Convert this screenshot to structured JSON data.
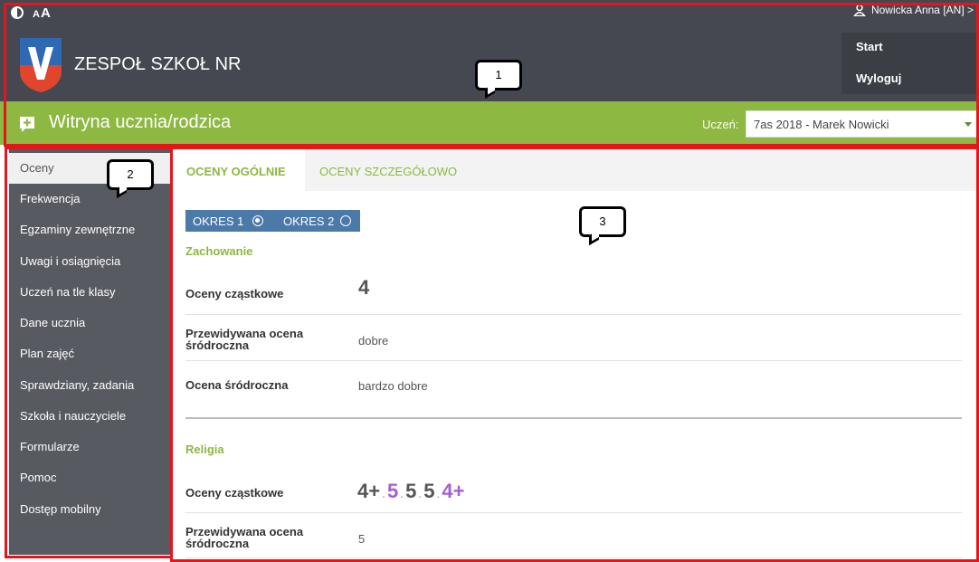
{
  "header": {
    "font_size_label_small": "A",
    "font_size_label_large": "A",
    "school_name": "ZESPOŁ SZKOŁ NR",
    "user_name": "Nowicka Anna [AN] >",
    "menu": [
      "Start",
      "Wyloguj"
    ]
  },
  "portal": {
    "title": "Witryna ucznia/rodzica",
    "student_label": "Uczeń:",
    "student_selected": "7as 2018 - Marek Nowicki"
  },
  "sidebar": {
    "items": [
      "Oceny",
      "Frekwencja",
      "Egzaminy zewnętrzne",
      "Uwagi i osiągnięcia",
      "Uczeń na tle klasy",
      "Dane ucznia",
      "Plan zajęć",
      "Sprawdziany, zadania",
      "Szkoła i nauczyciele",
      "Formularze",
      "Pomoc",
      "Dostęp mobilny"
    ],
    "active_index": 0
  },
  "tabs": [
    "OCENY OGÓLNIE",
    "OCENY SZCZEGÓŁOWO"
  ],
  "periods": [
    {
      "label": "OKRES 1",
      "selected": true
    },
    {
      "label": "OKRES 2",
      "selected": false
    }
  ],
  "subjects": [
    {
      "name": "Zachowanie",
      "partial_label": "Oceny cząstkowe",
      "partial_grades": "4",
      "predicted_label_line1": "Przewidywana ocena",
      "predicted_label_line2": "śródroczna",
      "predicted_value": "dobre",
      "midterm_label": "Ocena śródroczna",
      "midterm_value": "bardzo dobre"
    },
    {
      "name": "Religia",
      "partial_label": "Oceny cząstkowe",
      "partial_grades": [
        "4+",
        "5",
        "5",
        "5",
        "4+"
      ],
      "predicted_label_line1": "Przewidywana ocena",
      "predicted_label_line2": "śródroczna",
      "predicted_value": "5"
    }
  ],
  "callouts": [
    "1",
    "2",
    "3"
  ],
  "colors": {
    "header_bg": "#454850",
    "green": "#8db842",
    "sidebar_bg": "#585a62",
    "period_blue": "#4b79a8",
    "outline_red": "#e5151e",
    "grade_purple": "#a35fd6"
  }
}
